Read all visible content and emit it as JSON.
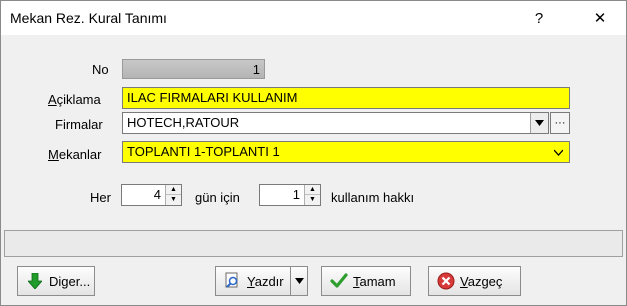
{
  "window": {
    "title": "Mekan Rez. Kural Tanımı",
    "help_glyph": "?",
    "close_glyph": "✕"
  },
  "form": {
    "no_label": "No",
    "no_value": "1",
    "aciklama_label": "Açiklama",
    "aciklama_value": "ILAC FIRMALARI KULLANIM",
    "firmalar_label": "Firmalar",
    "firmalar_value": "HOTECH,RATOUR",
    "firmalar_ellipsis": "···",
    "mekanlar_label": "Mekanlar",
    "mekanlar_value": "TOPLANTI 1-TOPLANTI 1",
    "her_label": "Her",
    "gun_value": "4",
    "gun_icin_label": "gün için",
    "kullanim_value": "1",
    "kullanim_label": "kullanım hakkı"
  },
  "buttons": {
    "diger": "Diger...",
    "yazdir": "Yazdır",
    "tamam": "Tamam",
    "vazgec": "Vazgeç"
  },
  "colors": {
    "highlight": "#ffff00",
    "ok_green": "#2e9e2e",
    "cancel_red": "#d83a3a",
    "arrow_green": "#1f9b2a"
  }
}
